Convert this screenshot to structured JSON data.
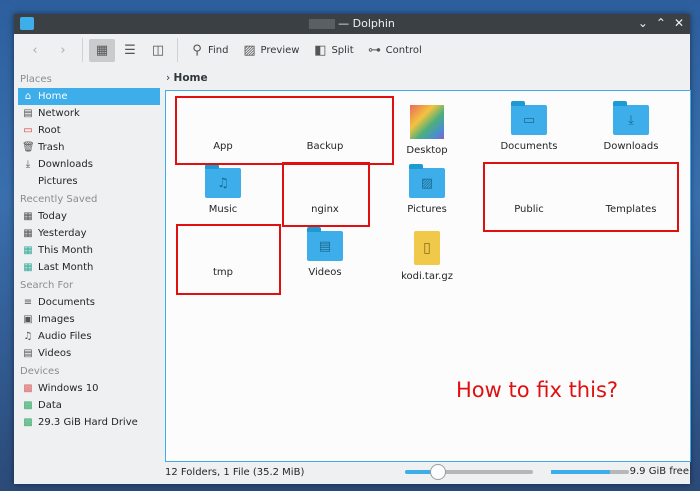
{
  "window": {
    "title": "— Dolphin",
    "controls": [
      "minimize",
      "maximize",
      "close"
    ]
  },
  "toolbar": {
    "back": "back-icon",
    "forward": "forward-icon",
    "find": "Find",
    "preview": "Preview",
    "split": "Split",
    "control": "Control"
  },
  "sidebar": {
    "places_header": "Places",
    "places": [
      {
        "label": "Home",
        "icon": "home-icon"
      },
      {
        "label": "Network",
        "icon": "network-icon"
      },
      {
        "label": "Root",
        "icon": "root-folder-icon"
      },
      {
        "label": "Trash",
        "icon": "trash-icon"
      },
      {
        "label": "Downloads",
        "icon": "downloads-icon"
      },
      {
        "label": "Pictures",
        "icon": ""
      }
    ],
    "recent_header": "Recently Saved",
    "recent": [
      {
        "label": "Today"
      },
      {
        "label": "Yesterday"
      },
      {
        "label": "This Month"
      },
      {
        "label": "Last Month"
      }
    ],
    "search_header": "Search For",
    "search": [
      {
        "label": "Documents"
      },
      {
        "label": "Images"
      },
      {
        "label": "Audio Files"
      },
      {
        "label": "Videos"
      }
    ],
    "devices_header": "Devices",
    "devices": [
      {
        "label": "Windows 10"
      },
      {
        "label": "Data"
      },
      {
        "label": "29.3 GiB Hard Drive"
      }
    ]
  },
  "breadcrumb": {
    "current": "Home"
  },
  "files": [
    {
      "name": "App",
      "type": "missing"
    },
    {
      "name": "Backup",
      "type": "missing"
    },
    {
      "name": "Desktop",
      "type": "desktop"
    },
    {
      "name": "Documents",
      "type": "folder"
    },
    {
      "name": "Downloads",
      "type": "folder"
    },
    {
      "name": "Music",
      "type": "folder"
    },
    {
      "name": "nginx",
      "type": "missing"
    },
    {
      "name": "Pictures",
      "type": "folder"
    },
    {
      "name": "Public",
      "type": "missing"
    },
    {
      "name": "Templates",
      "type": "missing"
    },
    {
      "name": "tmp",
      "type": "missing"
    },
    {
      "name": "Videos",
      "type": "folder"
    },
    {
      "name": "kodi.tar.gz",
      "type": "archive"
    }
  ],
  "annotation": "How to fix this?",
  "status": {
    "summary": "12 Folders, 1 File (35.2 MiB)",
    "zoom_level": 0.25,
    "disk_used": 0.75,
    "free": "9.9 GiB free"
  }
}
